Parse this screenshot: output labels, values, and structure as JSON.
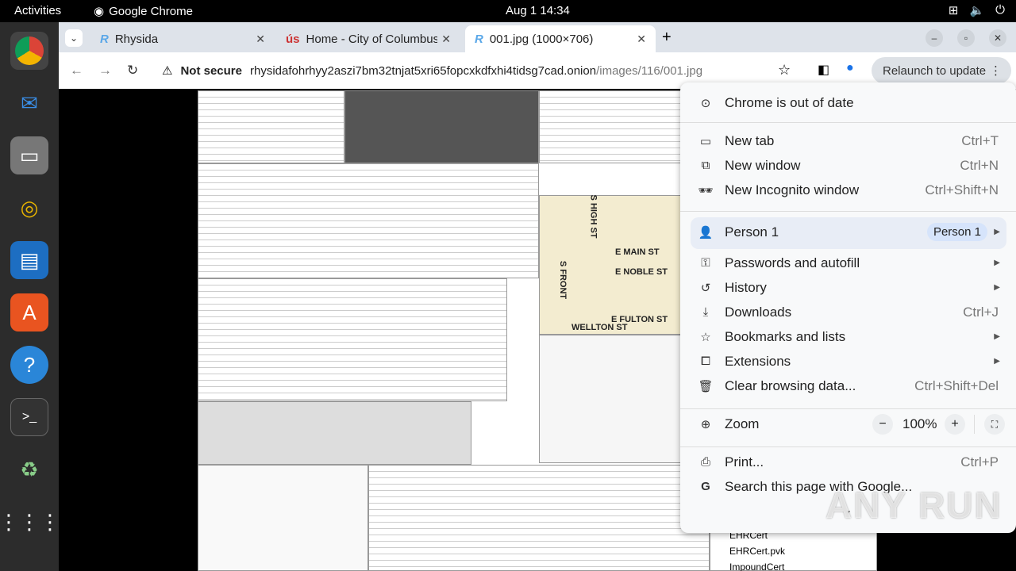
{
  "topbar": {
    "activities": "Activities",
    "app": "Google Chrome",
    "clock": "Aug 1  14:34"
  },
  "dock": [
    "chrome",
    "thunderbird",
    "files",
    "rhythmbox",
    "writer",
    "app-center",
    "help",
    "terminal",
    "trash",
    "apps-grid"
  ],
  "tabs": [
    {
      "title": "Rhysida",
      "favicon": "R"
    },
    {
      "title": "Home - City of Columbus",
      "favicon": "ús"
    },
    {
      "title": "001.jpg (1000×706)",
      "favicon": "R",
      "active": true
    }
  ],
  "toolbar": {
    "security": "Not secure",
    "url_host": "rhysidafohrhyy2aszi7bm32tnjat5xri65fopcxkdfxhi4tidsg7cad.onion",
    "url_path": "/images/116/001.jpg",
    "relaunch": "Relaunch to update"
  },
  "image": {
    "streets": [
      "E MAIN ST",
      "E NOBLE ST",
      "E FULTON ST",
      "S HIGH ST",
      "S FRONT",
      "WELLTON ST"
    ],
    "files": [
      "EHRCert",
      "EHRCert.pvk",
      "ImpoundCert"
    ]
  },
  "menu": {
    "update": "Chrome is out of date",
    "items1": [
      {
        "label": "New tab",
        "shortcut": "Ctrl+T"
      },
      {
        "label": "New window",
        "shortcut": "Ctrl+N"
      },
      {
        "label": "New Incognito window",
        "shortcut": "Ctrl+Shift+N"
      }
    ],
    "profile": {
      "label": "Person 1",
      "badge": "Person 1"
    },
    "items2": [
      {
        "label": "Passwords and autofill"
      },
      {
        "label": "History"
      },
      {
        "label": "Downloads",
        "shortcut": "Ctrl+J"
      },
      {
        "label": "Bookmarks and lists"
      },
      {
        "label": "Extensions"
      },
      {
        "label": "Clear browsing data...",
        "shortcut": "Ctrl+Shift+Del"
      }
    ],
    "zoom": {
      "label": "Zoom",
      "value": "100%",
      "minus": "−",
      "plus": "+"
    },
    "items3": [
      {
        "label": "Print...",
        "shortcut": "Ctrl+P"
      },
      {
        "label": "Search this page with Google..."
      }
    ]
  },
  "watermark": "ANY RUN"
}
